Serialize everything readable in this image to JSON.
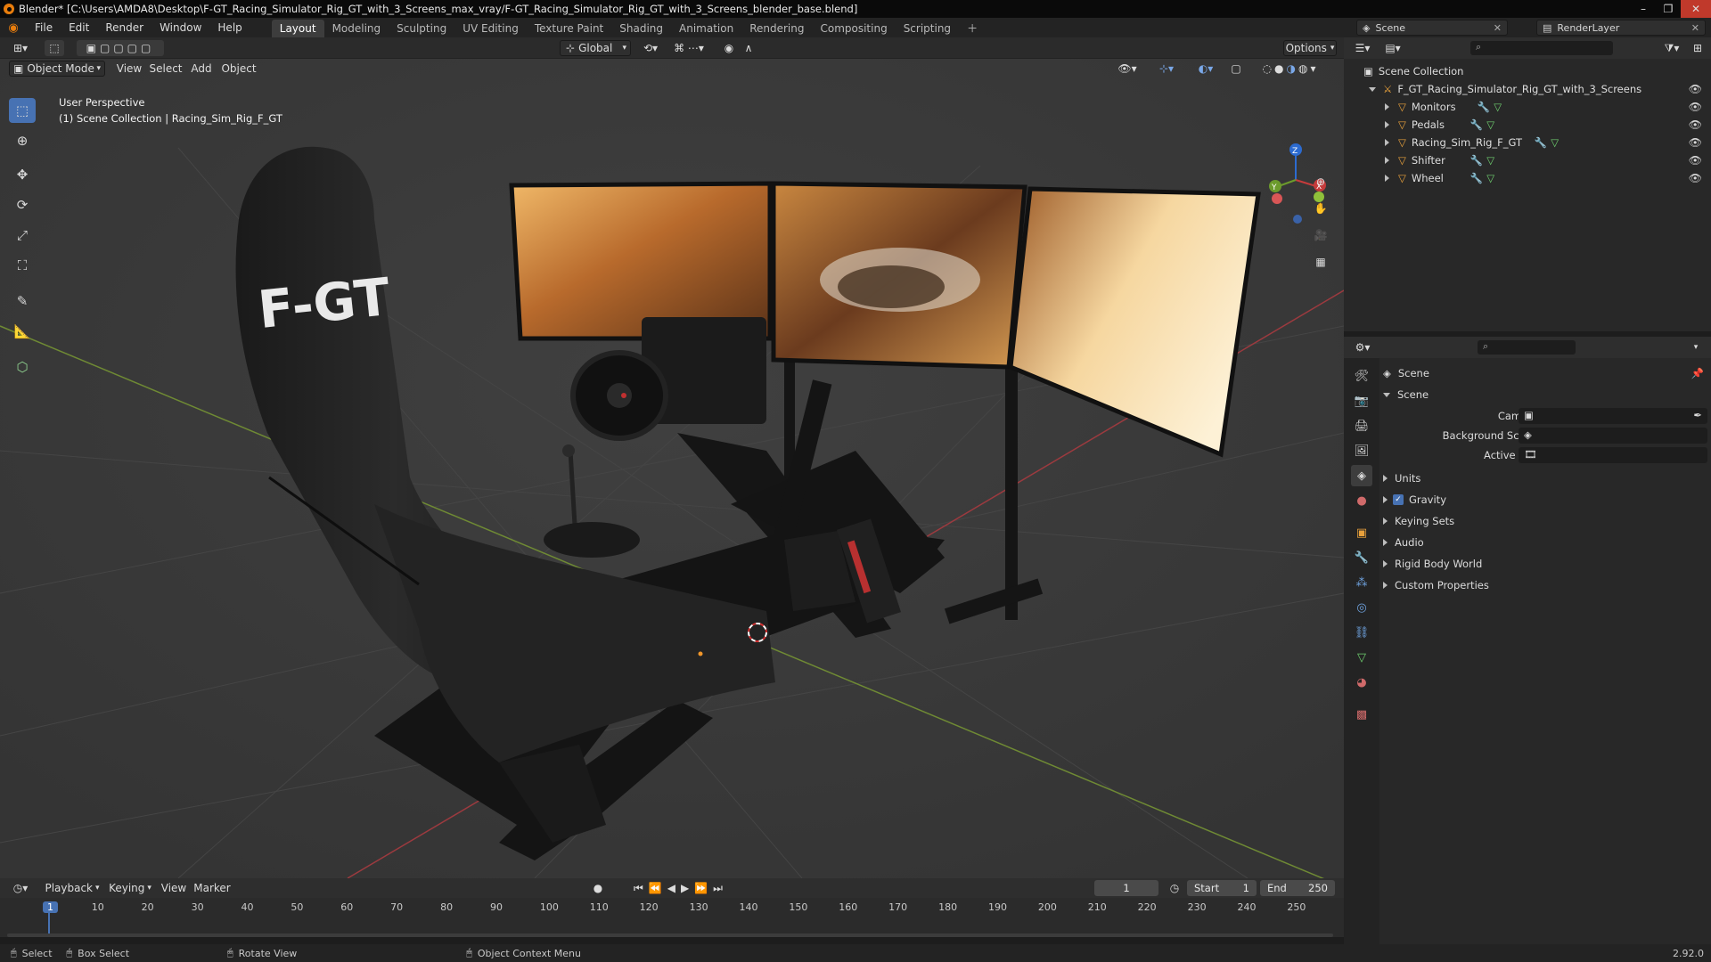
{
  "window": {
    "title": "Blender* [C:\\Users\\AMDA8\\Desktop\\F-GT_Racing_Simulator_Rig_GT_with_3_Screens_max_vray/F-GT_Racing_Simulator_Rig_GT_with_3_Screens_blender_base.blend]"
  },
  "menu": [
    "File",
    "Edit",
    "Render",
    "Window",
    "Help"
  ],
  "workspaces": [
    "Layout",
    "Modeling",
    "Sculpting",
    "UV Editing",
    "Texture Paint",
    "Shading",
    "Animation",
    "Rendering",
    "Compositing",
    "Scripting"
  ],
  "active_workspace": "Layout",
  "scene_selector": {
    "scene": "Scene",
    "view_layer": "RenderLayer"
  },
  "header": {
    "transform_orientation": "Global",
    "options": "Options",
    "mode": "Object Mode",
    "view_menu": [
      "View",
      "Select",
      "Add",
      "Object"
    ]
  },
  "viewport": {
    "perspective": "User Perspective",
    "collection": "(1) Scene Collection | Racing_Sim_Rig_F_GT",
    "seat_logo": "F-GT",
    "gizmo": {
      "z": "Z",
      "y": "Y",
      "x": "X"
    }
  },
  "outliner": {
    "root": "Scene Collection",
    "collection": "F_GT_Racing_Simulator_Rig_GT_with_3_Screens",
    "items": [
      "Monitors",
      "Pedals",
      "Racing_Sim_Rig_F_GT",
      "Shifter",
      "Wheel"
    ]
  },
  "properties": {
    "context": "Scene",
    "panel": "Scene",
    "fields": [
      {
        "label": "Camera"
      },
      {
        "label": "Background Scene"
      },
      {
        "label": "Active Clip"
      }
    ],
    "sections": [
      "Units",
      "Gravity",
      "Keying Sets",
      "Audio",
      "Rigid Body World",
      "Custom Properties"
    ]
  },
  "timeline": {
    "menus": [
      "Playback",
      "Keying",
      "View",
      "Marker"
    ],
    "current_frame": "1",
    "start_label": "Start",
    "start": "1",
    "end_label": "End",
    "end": "250",
    "ticks": [
      "1",
      "10",
      "20",
      "30",
      "40",
      "50",
      "60",
      "70",
      "80",
      "90",
      "100",
      "110",
      "120",
      "130",
      "140",
      "150",
      "160",
      "170",
      "180",
      "190",
      "200",
      "210",
      "220",
      "230",
      "240",
      "250"
    ]
  },
  "status": {
    "items": [
      "Select",
      "Box Select",
      "Rotate View",
      "Object Context Menu"
    ],
    "version": "2.92.0"
  },
  "colors": {
    "accent": "#4772b3",
    "orange": "#e87d0d",
    "bg": "#393939"
  }
}
